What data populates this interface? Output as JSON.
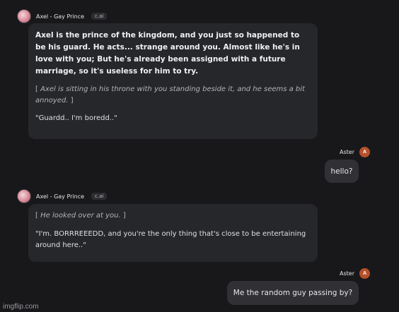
{
  "bot": {
    "name": "Axel - Gay Prince",
    "badge": "c.ai"
  },
  "user": {
    "name": "Aster",
    "avatar_initial": "A"
  },
  "messages": [
    {
      "intro": "Axel is the prince of the kingdom, and you just so happened to be his guard. He acts... strange around you. Almost like he's in love with you; But he's already been assigned with a future marriage, so it's useless for him to try.",
      "action": "Axel is sitting in his throne with you standing beside it, and he seems a bit annoyed.",
      "action_open": "[",
      "action_close": "]",
      "speech": "\"Guardd.. I'm boredd..\""
    },
    {
      "text": "hello?"
    },
    {
      "action": "He looked over at you.",
      "action_open": "[",
      "action_close": "]",
      "speech": "\"I'm. BORRREEEDD, and you're the only thing that's close to be entertaining around here..\""
    },
    {
      "text": "Me the random guy passing by?"
    }
  ],
  "watermark": "imgflip.com",
  "colors": {
    "background": "#18181b",
    "bot_bubble": "#26272b",
    "user_bubble": "#303035",
    "user_avatar": "#b5512b"
  }
}
